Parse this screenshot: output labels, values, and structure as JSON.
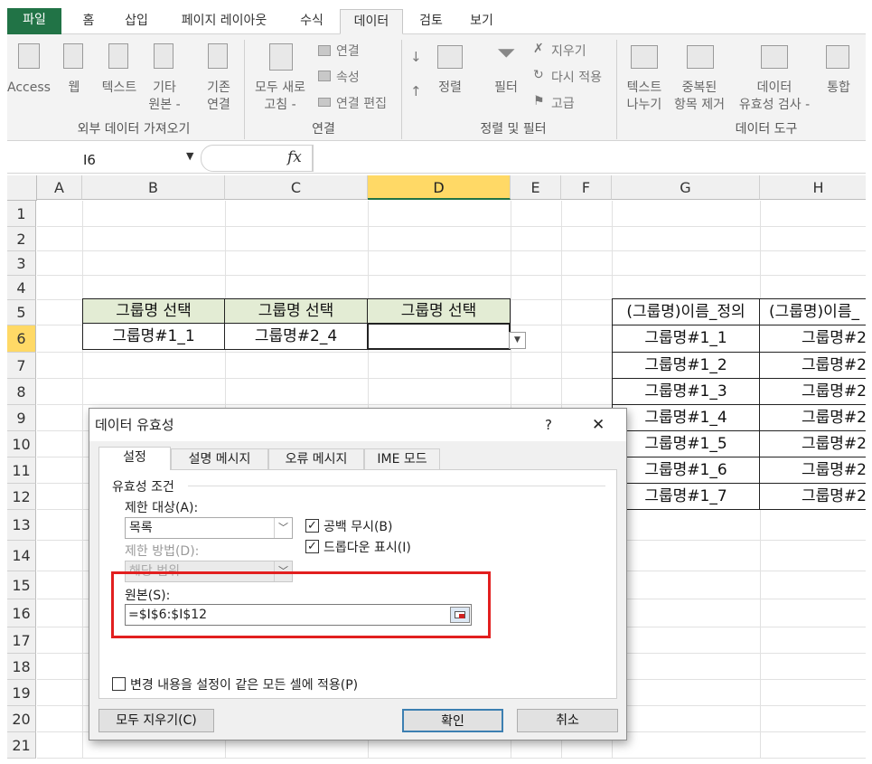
{
  "tabs": [
    "파일",
    "홈",
    "삽입",
    "페이지 레이아웃",
    "수식",
    "데이터",
    "검토",
    "보기"
  ],
  "ribbon": {
    "get_external": {
      "access": "Access",
      "web": "웹",
      "text": "텍스트",
      "other": [
        "기타",
        "원본 -"
      ],
      "existing": [
        "기존",
        "연결"
      ],
      "group_label": "외부 데이터 가져오기"
    },
    "connections": {
      "refresh_all": [
        "모두 새로",
        "고침 -"
      ],
      "connections": "연결",
      "properties": "속성",
      "edit_links": "연결 편집",
      "group_label": "연결"
    },
    "sort_filter": {
      "sort": "정렬",
      "filter": "필터",
      "clear": "지우기",
      "reapply": "다시 적용",
      "advanced": "고급",
      "group_label": "정렬 및 필터"
    },
    "data_tools": {
      "text_to_columns": [
        "텍스트",
        "나누기"
      ],
      "remove_duplicates": [
        "중복된",
        "항목 제거"
      ],
      "data_validation": [
        "데이터",
        "유효성 검사 -"
      ],
      "consolidate": "통합",
      "group_label": "데이터 도구"
    }
  },
  "formula_bar": {
    "name_box": "I6",
    "fx": "fx"
  },
  "columns": [
    "A",
    "B",
    "C",
    "D",
    "E",
    "F",
    "G",
    "H"
  ],
  "rows": [
    "1",
    "2",
    "3",
    "4",
    "5",
    "6",
    "7",
    "8",
    "9",
    "10",
    "11",
    "12",
    "13",
    "14",
    "15",
    "16",
    "17",
    "18",
    "19",
    "20",
    "21"
  ],
  "cells": {
    "b5": "그룹명 선택",
    "c5": "그룹명 선택",
    "d5": "그룹명 선택",
    "b6": "그룹명#1_1",
    "c6": "그룹명#2_4",
    "g5": "(그룹명)이름_정의",
    "h5": "(그룹명)이름_",
    "g_list": [
      "그룹명#1_1",
      "그룹명#1_2",
      "그룹명#1_3",
      "그룹명#1_4",
      "그룹명#1_5",
      "그룹명#1_6",
      "그룹명#1_7"
    ],
    "h_list": [
      "그룹명#2",
      "그룹명#2",
      "그룹명#2",
      "그룹명#2",
      "그룹명#2",
      "그룹명#2",
      "그룹명#2"
    ]
  },
  "dialog": {
    "title": "데이터 유효성",
    "help": "?",
    "close": "✕",
    "tabs": [
      "설정",
      "설명 메시지",
      "오류 메시지",
      "IME 모드"
    ],
    "criteria_label": "유효성 조건",
    "allow_label": "제한 대상(A):",
    "allow_value": "목록",
    "data_label": "제한 방법(D):",
    "data_value": "해당 범위",
    "ignore_blank": "공백 무시(B)",
    "dropdown": "드롭다운 표시(I)",
    "source_label": "원본(S):",
    "source_value": "=$I$6:$I$12",
    "apply_all": "변경 내용을 설정이 같은 모든 셀에 적용(P)",
    "clear_all": "모두 지우기(C)",
    "ok": "확인",
    "cancel": "취소"
  }
}
